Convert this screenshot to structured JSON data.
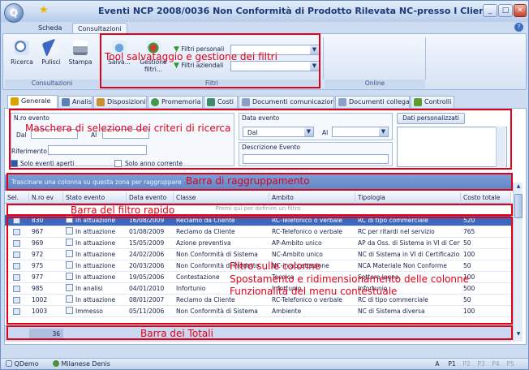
{
  "window": {
    "title": "Eventi NCP 2008/0036 Non Conformità di Prodotto Rilevata NC-presso I Clienti",
    "controls": {
      "minimize": "_",
      "maximize": "□",
      "close": "✕"
    }
  },
  "ribbon_tabs": [
    {
      "label": "Scheda",
      "active": false
    },
    {
      "label": "Consultazioni",
      "active": true
    }
  ],
  "ribbon": {
    "groups": [
      {
        "label": "Consultazioni",
        "buttons": [
          "Ricerca",
          "Pulisci",
          "Stampa"
        ]
      },
      {
        "label": "Filtri",
        "buttons": [
          "Salva...",
          "Gestione filtri..."
        ],
        "filter_labels": [
          "Filtri personali",
          "Filtri aziendali"
        ]
      },
      {
        "label": "Online"
      }
    ]
  },
  "annotations": {
    "tool": "Tool salvataggio e gestione dei filtri",
    "mask": "Maschera di selezione dei criteri di ricerca",
    "grouping": "Barra di raggruppamento",
    "quickfilter": "Barra del filtro rapido",
    "columns1": "Filtro sulle colonne",
    "columns2": "Spostamento e ridimensionamento delle colonne",
    "columns3": "Funzionalità del menu contestuale",
    "totals": "Barra dei Totali"
  },
  "form_tabs": [
    "Generale",
    "Analisi",
    "Disposizioni",
    "Promemoria",
    "Costi",
    "Documenti comunicazioni",
    "Documenti collegati",
    "Controlli"
  ],
  "search": {
    "nro_evento": {
      "title": "N.ro evento",
      "from": "Dal",
      "to": "Al"
    },
    "riferimento": "Riferimento",
    "solo_aperti": "Solo eventi aperti",
    "solo_anno": "Solo anno corrente",
    "data_evento": {
      "title": "Data evento",
      "from": "Dal",
      "to": "Al"
    },
    "descrizione": "Descrizione Evento",
    "dati_personalizzati": "Dati personalizzati"
  },
  "grid": {
    "group_hint": "Trascinare una colonna su questa zona per raggruppare",
    "filter_hint": "Premi qui per definire un filtro",
    "columns": [
      "Sel.",
      "N.ro ev",
      "Stato evento",
      "Data evento",
      "Classe",
      "Ambito",
      "Tipologia",
      "Costo totale"
    ],
    "rows": [
      [
        "830",
        "In attuazione",
        "16/08/2009",
        "Reclamo da Cliente",
        "RC-Telefonico o verbale",
        "RC di tipo commerciale",
        "520"
      ],
      [
        "967",
        "In attuazione",
        "01/08/2009",
        "Reclamo da Cliente",
        "RC-Telefonico o verbale",
        "RC per ritardi nel servizio",
        "765"
      ],
      [
        "969",
        "In attuazione",
        "15/05/2009",
        "Azione preventiva",
        "AP-Ambito unico",
        "AP da Oss. di Sistema in VI di Cert.",
        "50"
      ],
      [
        "972",
        "In attuazione",
        "24/02/2006",
        "Non Conformità di Sistema",
        "NC-Ambito unico",
        "NC di Sistema in VI di Certificazione",
        "100"
      ],
      [
        "975",
        "In attuazione",
        "20/03/2006",
        "Non Conformità di Prodotto",
        "NC-in accettazione",
        "NCA Materiale Non Conforme",
        "50"
      ],
      [
        "977",
        "In attuazione",
        "19/05/2006",
        "Contestazione",
        "Tecnica",
        "Settore legno",
        "100"
      ],
      [
        "985",
        "In analisi",
        "04/01/2010",
        "Infortunio",
        "Infortunio",
        "Infortunio",
        "500"
      ],
      [
        "1002",
        "In attuazione",
        "08/01/2007",
        "Reclamo da Cliente",
        "RC-Telefonico o verbale",
        "RC di tipo commerciale",
        "50"
      ],
      [
        "1003",
        "Immesso",
        "05/11/2006",
        "Non Conformità di Sistema",
        "Ambiente",
        "NC di Sistema diversa",
        "100"
      ]
    ],
    "selected_index": 0,
    "total_count": "36"
  },
  "statusbar": {
    "db": "QDemo",
    "user": "Milanese Denis",
    "mode": "A",
    "pages": [
      "P1",
      "P2",
      "P3",
      "P4",
      "P5"
    ]
  },
  "colors": {
    "accent": "#3c67bb",
    "annotation": "#e0001a"
  }
}
